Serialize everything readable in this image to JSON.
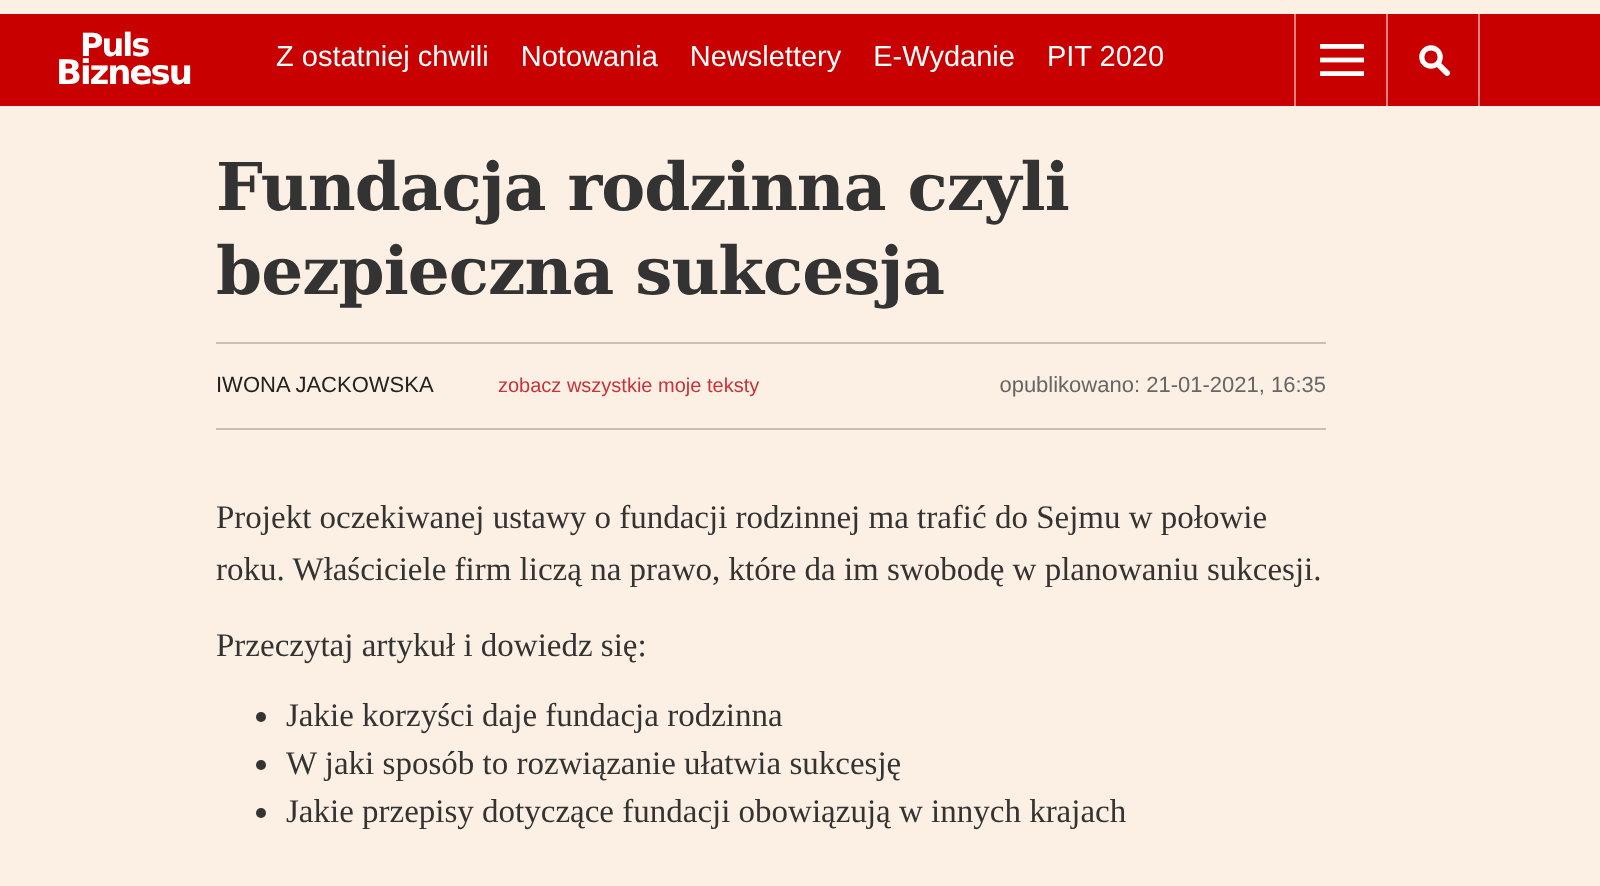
{
  "header": {
    "logo": [
      "Puls",
      "Biznesu"
    ],
    "nav": [
      "Z ostatniej chwili",
      "Notowania",
      "Newslettery",
      "E-Wydanie",
      "PIT 2020"
    ]
  },
  "article": {
    "title": "Fundacja rodzinna czyli bezpieczna sukcesja",
    "author": "IWONA JACKOWSKA",
    "author_link": "zobacz wszystkie moje teksty",
    "published": "opublikowano: 21-01-2021, 16:35",
    "lead": "Projekt oczekiwanej ustawy o fundacji rodzinnej ma trafić do Sejmu w połowie roku. Właściciele firm liczą na prawo, które da im swobodę w planowaniu sukcesji.",
    "intro": "Przeczytaj artykuł i dowiedz się:",
    "bullets": [
      "Jakie korzyści daje fundacja rodzinna",
      "W jaki sposób to rozwiązanie ułatwia sukcesję",
      "Jakie przepisy dotyczące fundacji obowiązują w innych krajach"
    ]
  }
}
